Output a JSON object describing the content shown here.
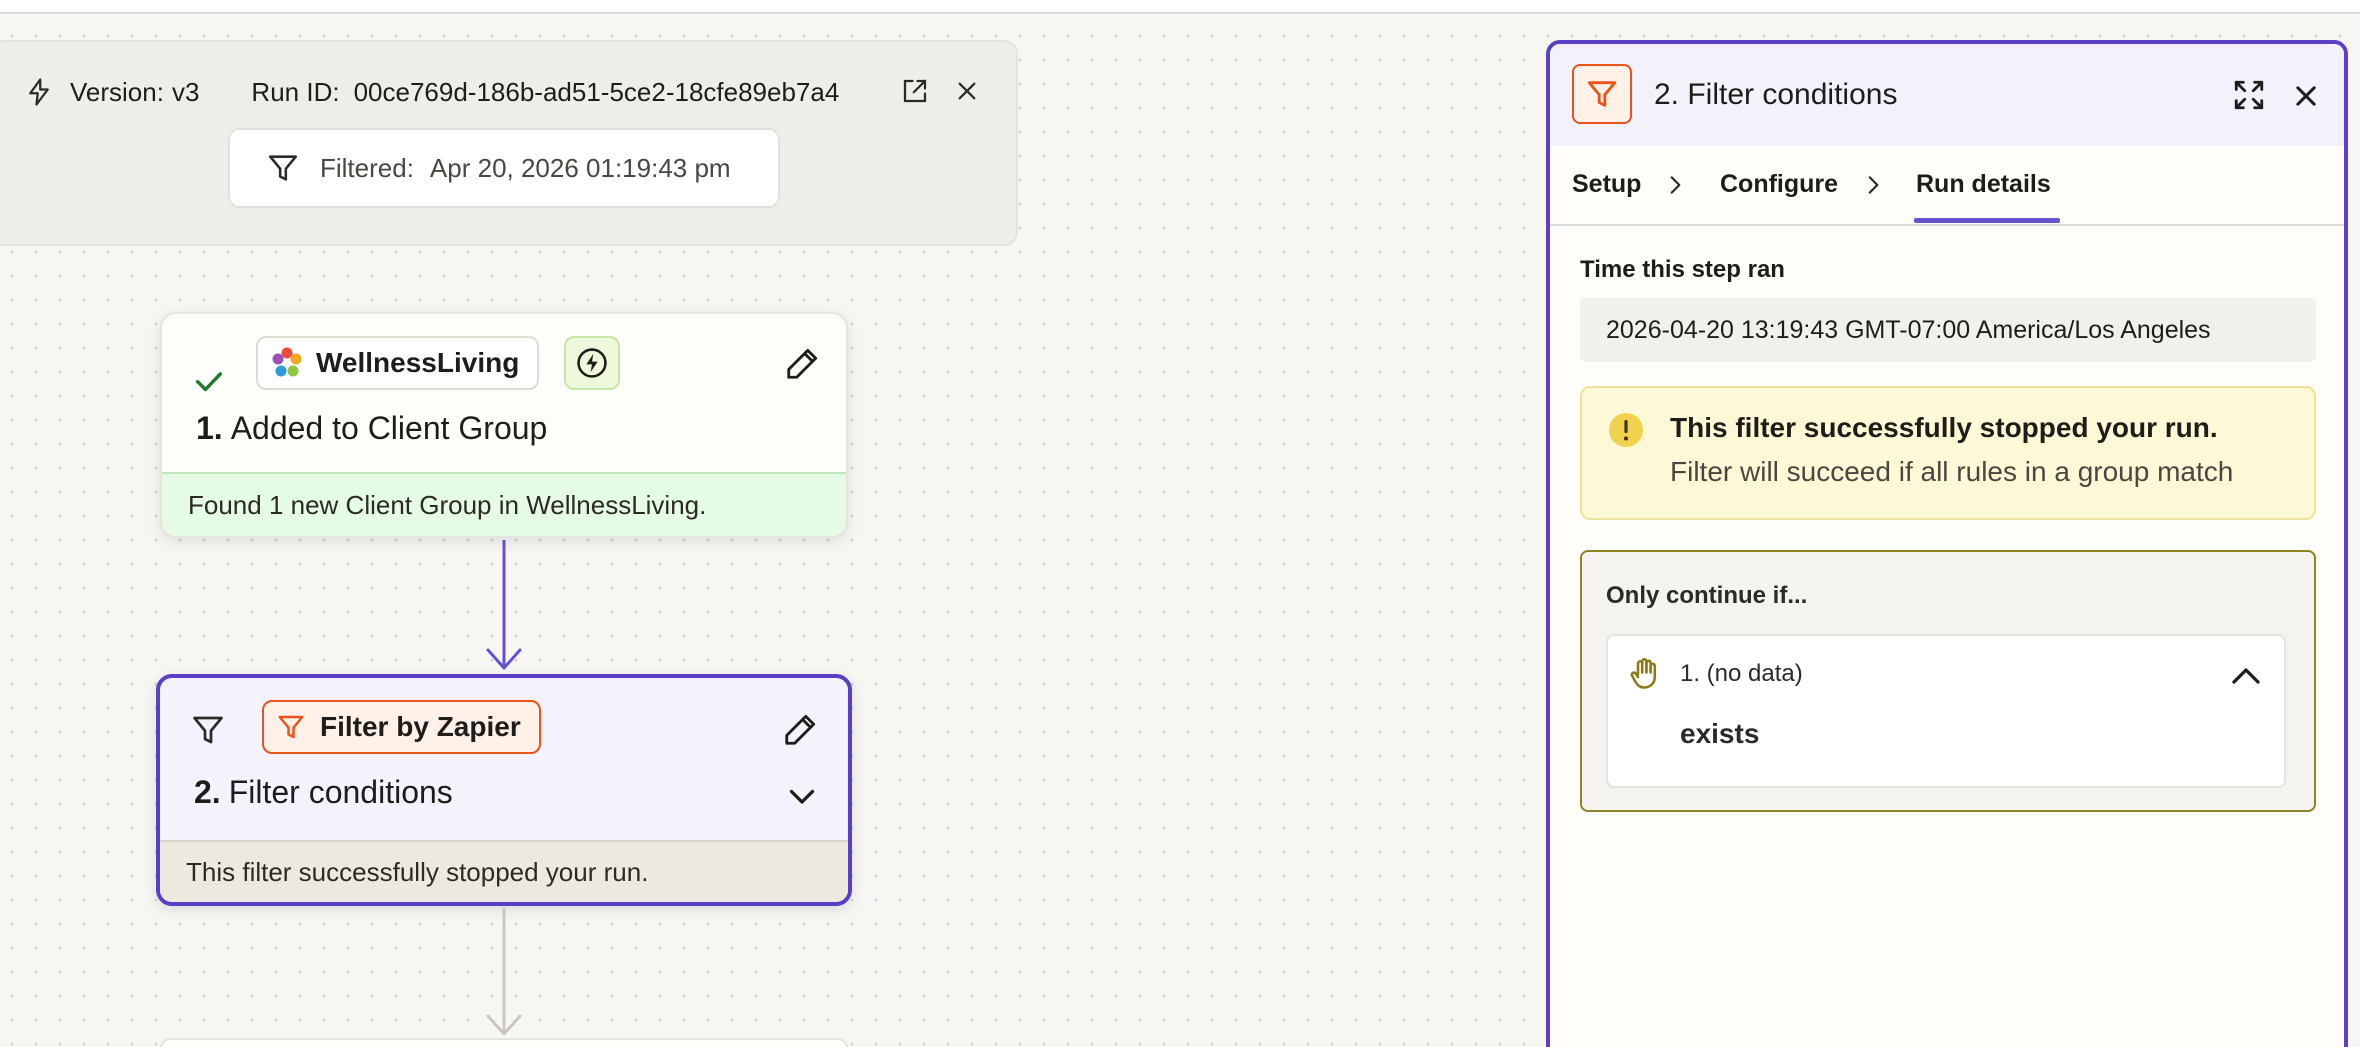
{
  "run_header": {
    "version_label": "Version:",
    "version_value": "v3",
    "run_id_label": "Run ID:",
    "run_id_value": "00ce769d-186b-ad51-5ce2-18cfe89eb7a4",
    "filtered_label": "Filtered:",
    "filtered_value": "Apr 20, 2026 01:19:43 pm",
    "icons": [
      "bolt-icon",
      "open-external-icon",
      "close-icon",
      "filter-icon"
    ]
  },
  "steps": [
    {
      "app_name": "WellnessLiving",
      "number": "1.",
      "title": "Added to Client Group",
      "status_text": "Found 1 new Client Group in WellnessLiving.",
      "icons": [
        "check-icon",
        "flower-logo-icon",
        "trigger-bolt-icon",
        "pencil-icon"
      ]
    },
    {
      "app_name": "Filter by Zapier",
      "number": "2.",
      "title": "Filter conditions",
      "status_text": "This filter successfully stopped your run.",
      "icons": [
        "filter-icon",
        "filter-logo-icon",
        "pencil-icon",
        "chevron-down-icon"
      ]
    }
  ],
  "side_panel": {
    "title": "2. Filter conditions",
    "tabs": [
      "Setup",
      "Configure",
      "Run details"
    ],
    "active_tab": "Run details",
    "time_label": "Time this step ran",
    "time_value": "2026-04-20 13:19:43 GMT-07:00 America/Los Angeles",
    "alert_title": "This filter successfully stopped your run.",
    "alert_text": "Filter will succeed if all rules in a group match",
    "condition_label": "Only continue if...",
    "rule_field": "1. (no data)",
    "rule_operator": "exists"
  },
  "colors": {
    "accent": "#5b3fc4",
    "zapier_orange": "#e8541c",
    "success_green": "#e6fbe3",
    "warning_yellow": "#fdf8d5",
    "condition_border": "#8d8324"
  }
}
